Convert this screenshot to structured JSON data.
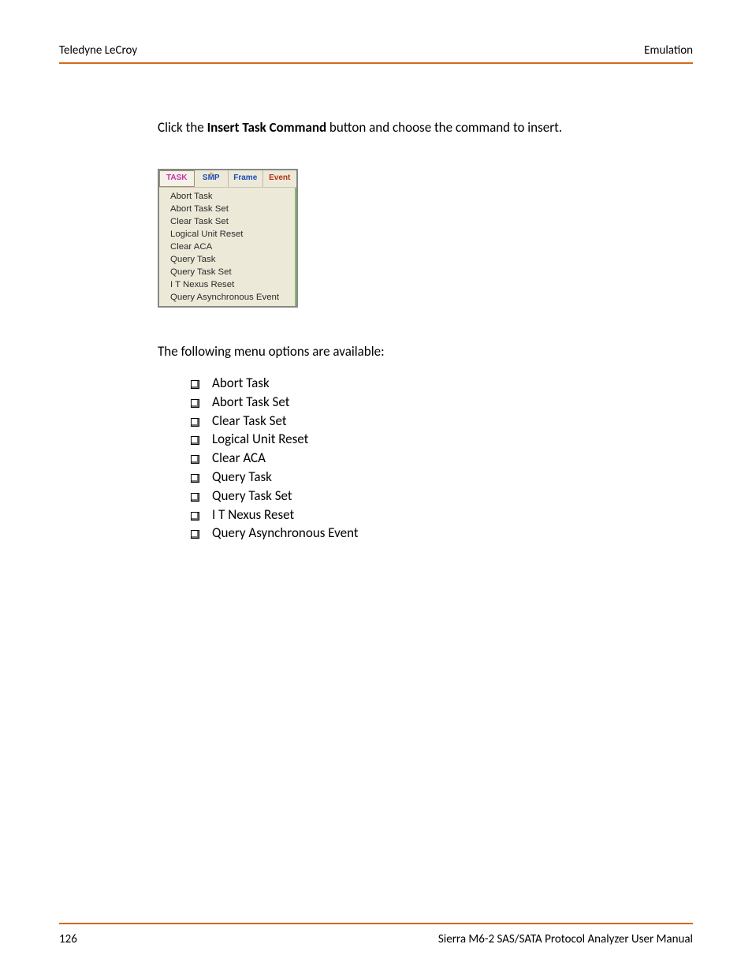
{
  "header": {
    "left": "Teledyne LeCroy",
    "right": "Emulation"
  },
  "intro": {
    "pre": "Click the ",
    "bold": "Insert Task Command",
    "post": " button and choose the command to insert."
  },
  "toolbar": {
    "task": "TASK",
    "smp": "SMP",
    "frame": "Frame",
    "event": "Event"
  },
  "dropdown": {
    "items": [
      "Abort Task",
      "Abort Task Set",
      "Clear Task Set",
      "Logical Unit Reset",
      "Clear ACA",
      "Query Task",
      "Query Task Set",
      "I T Nexus Reset",
      "Query Asynchronous Event"
    ]
  },
  "options_label": "The following menu options are available:",
  "options": [
    "Abort Task",
    "Abort Task Set",
    "Clear Task Set",
    "Logical Unit Reset",
    "Clear ACA",
    "Query Task",
    "Query Task Set",
    "I T Nexus Reset",
    "Query Asynchronous Event"
  ],
  "footer": {
    "page_number": "126",
    "manual": "Sierra M6-2 SAS/SATA Protocol Analyzer User Manual"
  }
}
